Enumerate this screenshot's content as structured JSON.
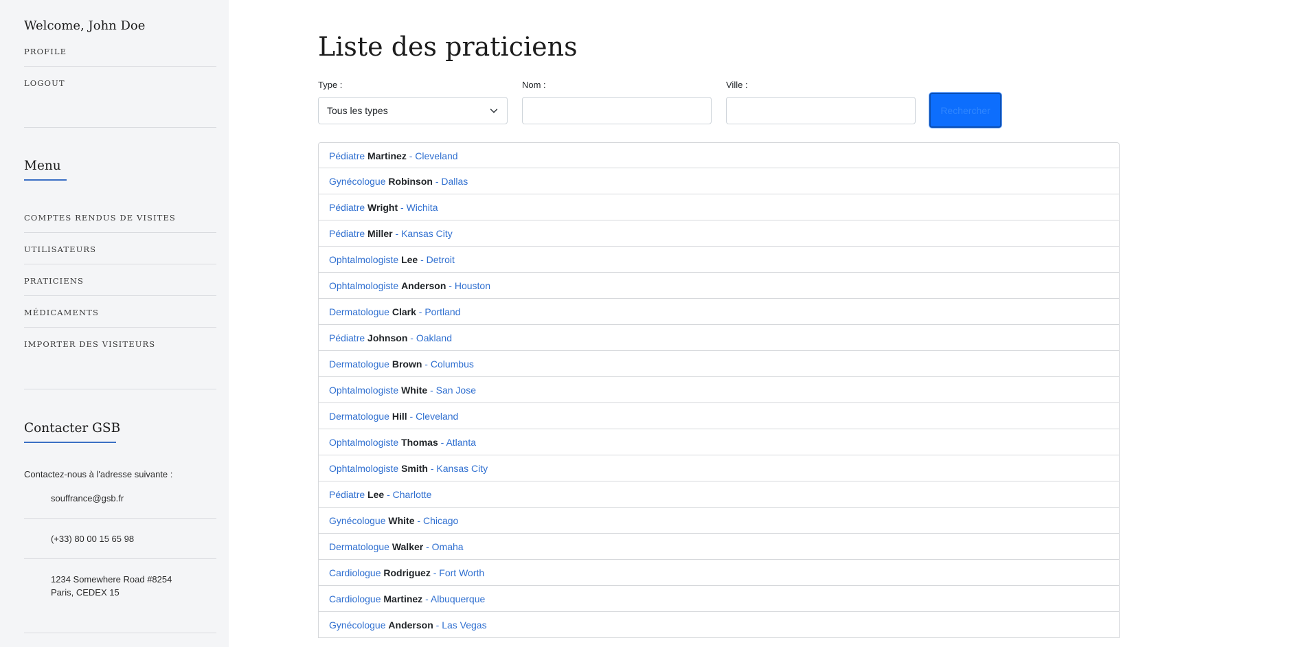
{
  "sidebar": {
    "welcome": "Welcome, John Doe",
    "profile_link": "PROFILE",
    "logout_link": "LOGOUT",
    "menu_heading": "Menu",
    "menu_items": [
      "COMPTES RENDUS DE VISITES",
      "UTILISATEURS",
      "PRATICIENS",
      "MÉDICAMENTS",
      "IMPORTER DES VISITEURS"
    ],
    "contact_heading": "Contacter GSB",
    "contact_intro": "Contactez-nous à l'adresse suivante :",
    "email": "souffrance@gsb.fr",
    "phone": "(+33) 80 00 15 65 98",
    "address_line1": "1234 Somewhere Road #8254",
    "address_line2": "Paris, CEDEX 15"
  },
  "main": {
    "title": "Liste des praticiens",
    "filters": {
      "type_label": "Type :",
      "type_value": "Tous les types",
      "name_label": "Nom :",
      "name_value": "",
      "city_label": "Ville :",
      "city_value": ""
    },
    "search_button": "Rechercher",
    "practitioners": [
      {
        "type": "Pédiatre",
        "name": "Martinez",
        "city": "Cleveland"
      },
      {
        "type": "Gynécologue",
        "name": "Robinson",
        "city": "Dallas"
      },
      {
        "type": "Pédiatre",
        "name": "Wright",
        "city": "Wichita"
      },
      {
        "type": "Pédiatre",
        "name": "Miller",
        "city": "Kansas City"
      },
      {
        "type": "Ophtalmologiste",
        "name": "Lee",
        "city": "Detroit"
      },
      {
        "type": "Ophtalmologiste",
        "name": "Anderson",
        "city": "Houston"
      },
      {
        "type": "Dermatologue",
        "name": "Clark",
        "city": "Portland"
      },
      {
        "type": "Pédiatre",
        "name": "Johnson",
        "city": "Oakland"
      },
      {
        "type": "Dermatologue",
        "name": "Brown",
        "city": "Columbus"
      },
      {
        "type": "Ophtalmologiste",
        "name": "White",
        "city": "San Jose"
      },
      {
        "type": "Dermatologue",
        "name": "Hill",
        "city": "Cleveland"
      },
      {
        "type": "Ophtalmologiste",
        "name": "Thomas",
        "city": "Atlanta"
      },
      {
        "type": "Ophtalmologiste",
        "name": "Smith",
        "city": "Kansas City"
      },
      {
        "type": "Pédiatre",
        "name": "Lee",
        "city": "Charlotte"
      },
      {
        "type": "Gynécologue",
        "name": "White",
        "city": "Chicago"
      },
      {
        "type": "Dermatologue",
        "name": "Walker",
        "city": "Omaha"
      },
      {
        "type": "Cardiologue",
        "name": "Rodriguez",
        "city": "Fort Worth"
      },
      {
        "type": "Cardiologue",
        "name": "Martinez",
        "city": "Albuquerque"
      },
      {
        "type": "Gynécologue",
        "name": "Anderson",
        "city": "Las Vegas"
      }
    ],
    "separator": "-"
  },
  "colors": {
    "link_blue": "#2f6fd0",
    "primary_button": "#0d6efd",
    "sidebar_bg": "#f4f5f7",
    "heading_underline": "#3a6fc4"
  }
}
